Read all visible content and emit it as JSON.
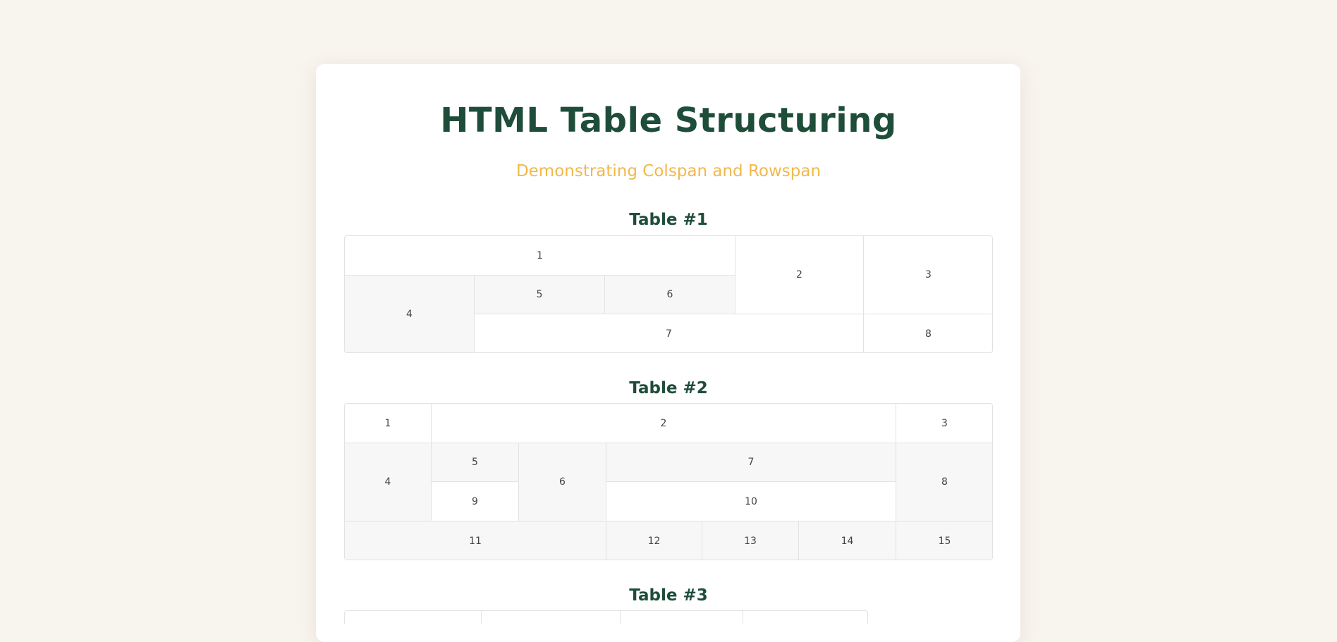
{
  "header": {
    "title": "HTML Table Structuring",
    "subtitle": "Demonstrating Colspan and Rowspan"
  },
  "tables": [
    {
      "heading": "Table #1",
      "cells": [
        "1",
        "2",
        "3",
        "4",
        "5",
        "6",
        "7",
        "8"
      ]
    },
    {
      "heading": "Table #2",
      "cells": [
        "1",
        "2",
        "3",
        "4",
        "5",
        "6",
        "7",
        "8",
        "9",
        "10",
        "11",
        "12",
        "13",
        "14",
        "15"
      ]
    },
    {
      "heading": "Table #3"
    }
  ],
  "colors": {
    "page_background": "#f8f4ee",
    "title": "#1e4d3a",
    "subtitle": "#f2b84b",
    "shaded_cell": "#f7f7f7",
    "border": "#e2e2e2"
  }
}
